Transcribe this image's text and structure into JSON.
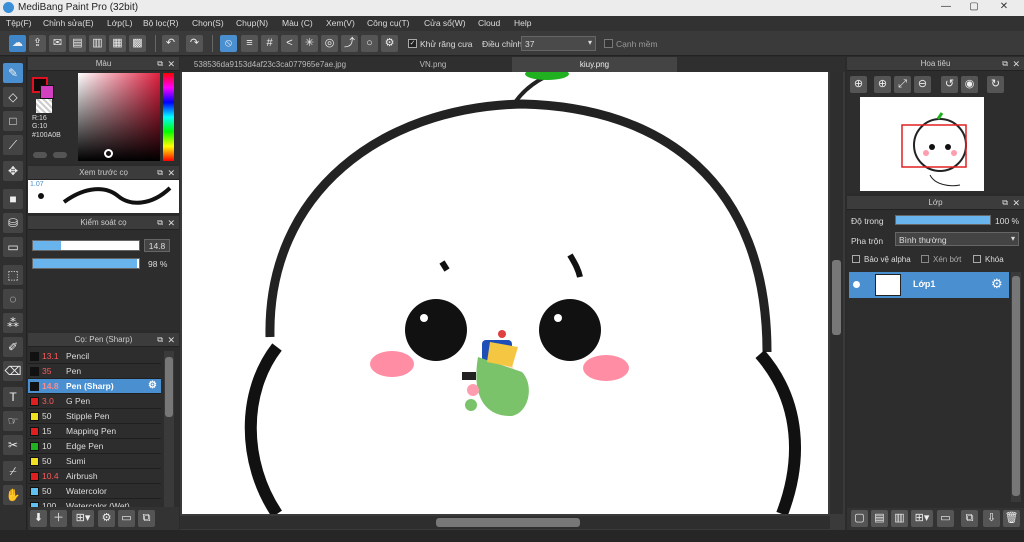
{
  "app": {
    "title": "MediBang Paint Pro (32bit)"
  },
  "menu": [
    "Tệp(F)",
    "Chỉnh sửa(E)",
    "Lớp(L)",
    "Bộ lọc(R)",
    "Chọn(S)",
    "Chụp(N)",
    "Màu (C)",
    "Xem(V)",
    "Công cụ(T)",
    "Cửa sổ(W)",
    "Cloud",
    "Help"
  ],
  "toolbar": {
    "antialias_label": "Khử răng cưa",
    "adjust_label": "Điều chỉnh",
    "adjust_value": "37",
    "edge_label": "Cạnh mềm"
  },
  "color_panel": {
    "title": "Màu",
    "r": "R:16",
    "g": "G:10",
    "hex": "#100A0B"
  },
  "brush_preview": {
    "title": "Xem trước cọ",
    "zoom": "1.07"
  },
  "brush_control": {
    "title": "Kiểm soát cọ",
    "size": "14.8",
    "opacity": "98 %",
    "size_frac": 0.26,
    "opacity_frac": 0.98
  },
  "brush_panel": {
    "title": "Cọ: Pen (Sharp)",
    "items": [
      {
        "size": "13.1",
        "name": "Pencil",
        "color": "#111111",
        "red": true
      },
      {
        "size": "35",
        "name": "Pen",
        "color": "#111111",
        "red": true
      },
      {
        "size": "14.8",
        "name": "Pen (Sharp)",
        "color": "#111111",
        "red": false,
        "selected": true
      },
      {
        "size": "3.0",
        "name": "G Pen",
        "color": "#e02020",
        "red": true
      },
      {
        "size": "50",
        "name": "Stipple Pen",
        "color": "#f0e020",
        "red": false
      },
      {
        "size": "15",
        "name": "Mapping Pen",
        "color": "#e02020",
        "red": false
      },
      {
        "size": "10",
        "name": "Edge Pen",
        "color": "#20b020",
        "red": false
      },
      {
        "size": "50",
        "name": "Sumi",
        "color": "#f0e020",
        "red": false
      },
      {
        "size": "10.4",
        "name": "Airbrush",
        "color": "#e02020",
        "red": true
      },
      {
        "size": "50",
        "name": "Watercolor",
        "color": "#60c0f0",
        "red": false
      },
      {
        "size": "100",
        "name": "Watercolor (Wet)",
        "color": "#60c0f0",
        "red": false
      }
    ]
  },
  "tabs": [
    "538536da9153d4af23c3ca077965e7ae.jpg",
    "VN.png",
    "kiuy.png"
  ],
  "navigator": {
    "title": "Hoa tiêu"
  },
  "layers": {
    "title": "Lớp",
    "opacity_label": "Độ trong",
    "opacity_value": "100 %",
    "opacity_frac": 1.0,
    "blend_label": "Pha trộn",
    "blend_value": "Bình thường",
    "protect_alpha": "Bảo vệ alpha",
    "clipping": "Xén bớt",
    "lock": "Khóa",
    "layer_name": "Lớp1"
  },
  "accent": "#4a8fd0"
}
